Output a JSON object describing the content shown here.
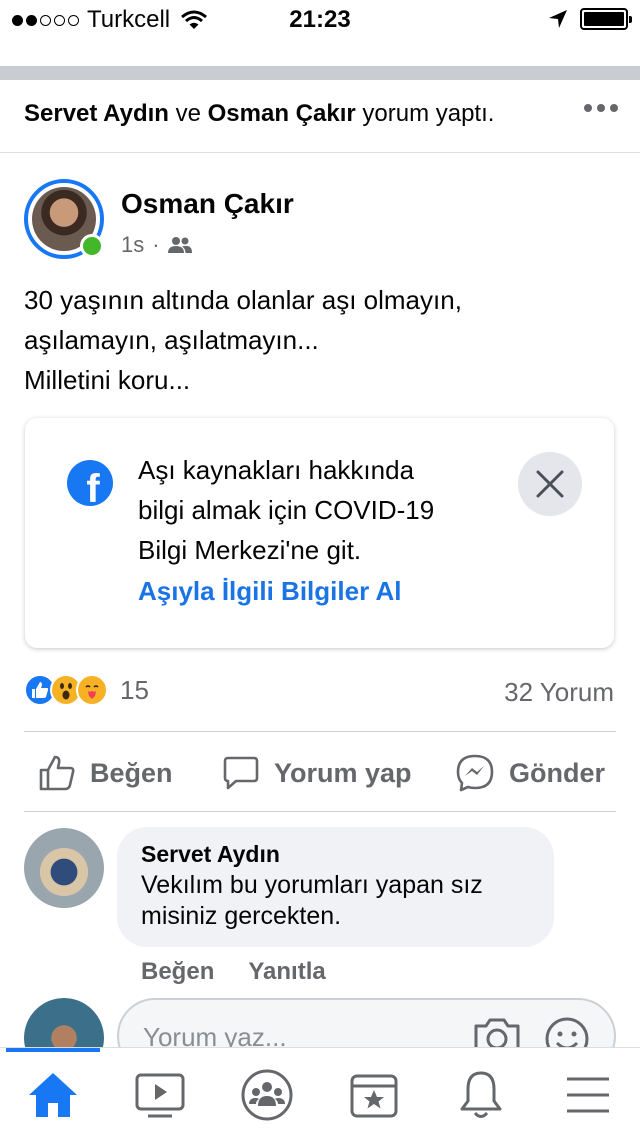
{
  "status_bar": {
    "carrier": "Turkcell",
    "time": "21:23",
    "signal_bars_filled": 2,
    "signal_bars_total": 5
  },
  "activity": {
    "user1": "Servet Aydın",
    "conjunction": "ve",
    "user2": "Osman Çakır",
    "action": "yorum yaptı."
  },
  "post": {
    "author": "Osman Çakır",
    "time": "1s",
    "separator": "·",
    "audience_icon": "friends-icon",
    "text": "30 yaşının altında olanlar aşı olmayın,\naşılamayın, aşılatmayın...\nMilletini koru..."
  },
  "info_card": {
    "icon": "facebook-logo-icon",
    "logo_glyph": "f",
    "text": "Aşı kaynakları hakkında\nbilgi almak için COVID-19\nBilgi Merkezi'ne git.",
    "link": "Aşıyla İlgili Bilgiler Al"
  },
  "reactions": {
    "types": [
      "like",
      "wow",
      "care"
    ],
    "count": "15",
    "comments": "32 Yorum"
  },
  "actions": {
    "like": "Beğen",
    "comment": "Yorum yap",
    "share": "Gönder"
  },
  "comment": {
    "author": "Servet Aydın",
    "text": "Vekılım bu yorumları yapan sız\nmisiniz gercekten.",
    "like": "Beğen",
    "reply": "Yanıtla"
  },
  "composer": {
    "placeholder": "Yorum yaz..."
  },
  "tabs": [
    "home",
    "watch",
    "groups",
    "pages",
    "notifications",
    "menu"
  ],
  "colors": {
    "accent": "#1877f2",
    "link": "#1b74e4",
    "secondary_text": "#65676b",
    "online": "#42b72a"
  }
}
